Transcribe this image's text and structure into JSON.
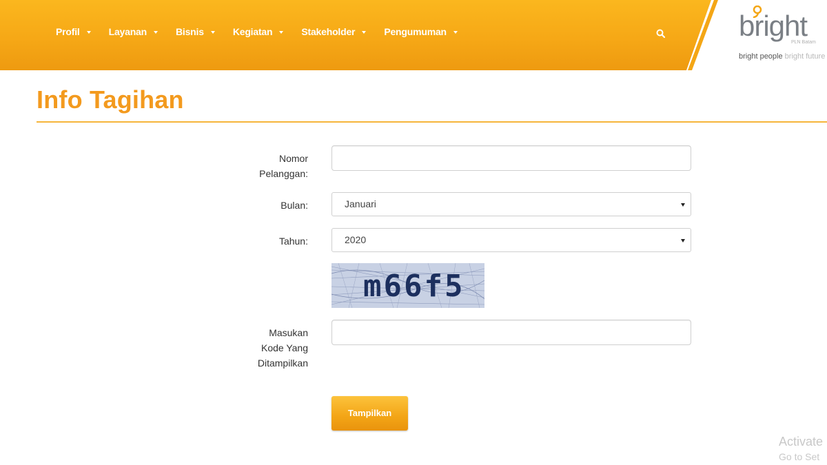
{
  "nav": {
    "items": [
      {
        "label": "Profil"
      },
      {
        "label": "Layanan"
      },
      {
        "label": "Bisnis"
      },
      {
        "label": "Kegiatan"
      },
      {
        "label": "Stakeholder"
      },
      {
        "label": "Pengumuman"
      }
    ],
    "search_icon": "search-icon"
  },
  "logo": {
    "word": "bright",
    "sub": "PLN Batam",
    "tag_dark": "bright people",
    "tag_light": "bright future"
  },
  "page": {
    "title": "Info Tagihan"
  },
  "form": {
    "nomor_label_1": "Nomor",
    "nomor_label_2": "Pelanggan:",
    "nomor_value": "",
    "bulan_label": "Bulan:",
    "bulan_value": "Januari",
    "tahun_label": "Tahun:",
    "tahun_value": "2020",
    "captcha_text": "m66f5",
    "kode_label_1": "Masukan",
    "kode_label_2": "Kode Yang",
    "kode_label_3": "Ditampilkan",
    "kode_value": "",
    "submit_label": "Tampilkan"
  },
  "watermark": {
    "line1": "Activate",
    "line2": "Go to Set"
  },
  "colors": {
    "accent": "#f39a1e",
    "nav_bg": "#f6a816",
    "logo_grey": "#7a7f85"
  }
}
